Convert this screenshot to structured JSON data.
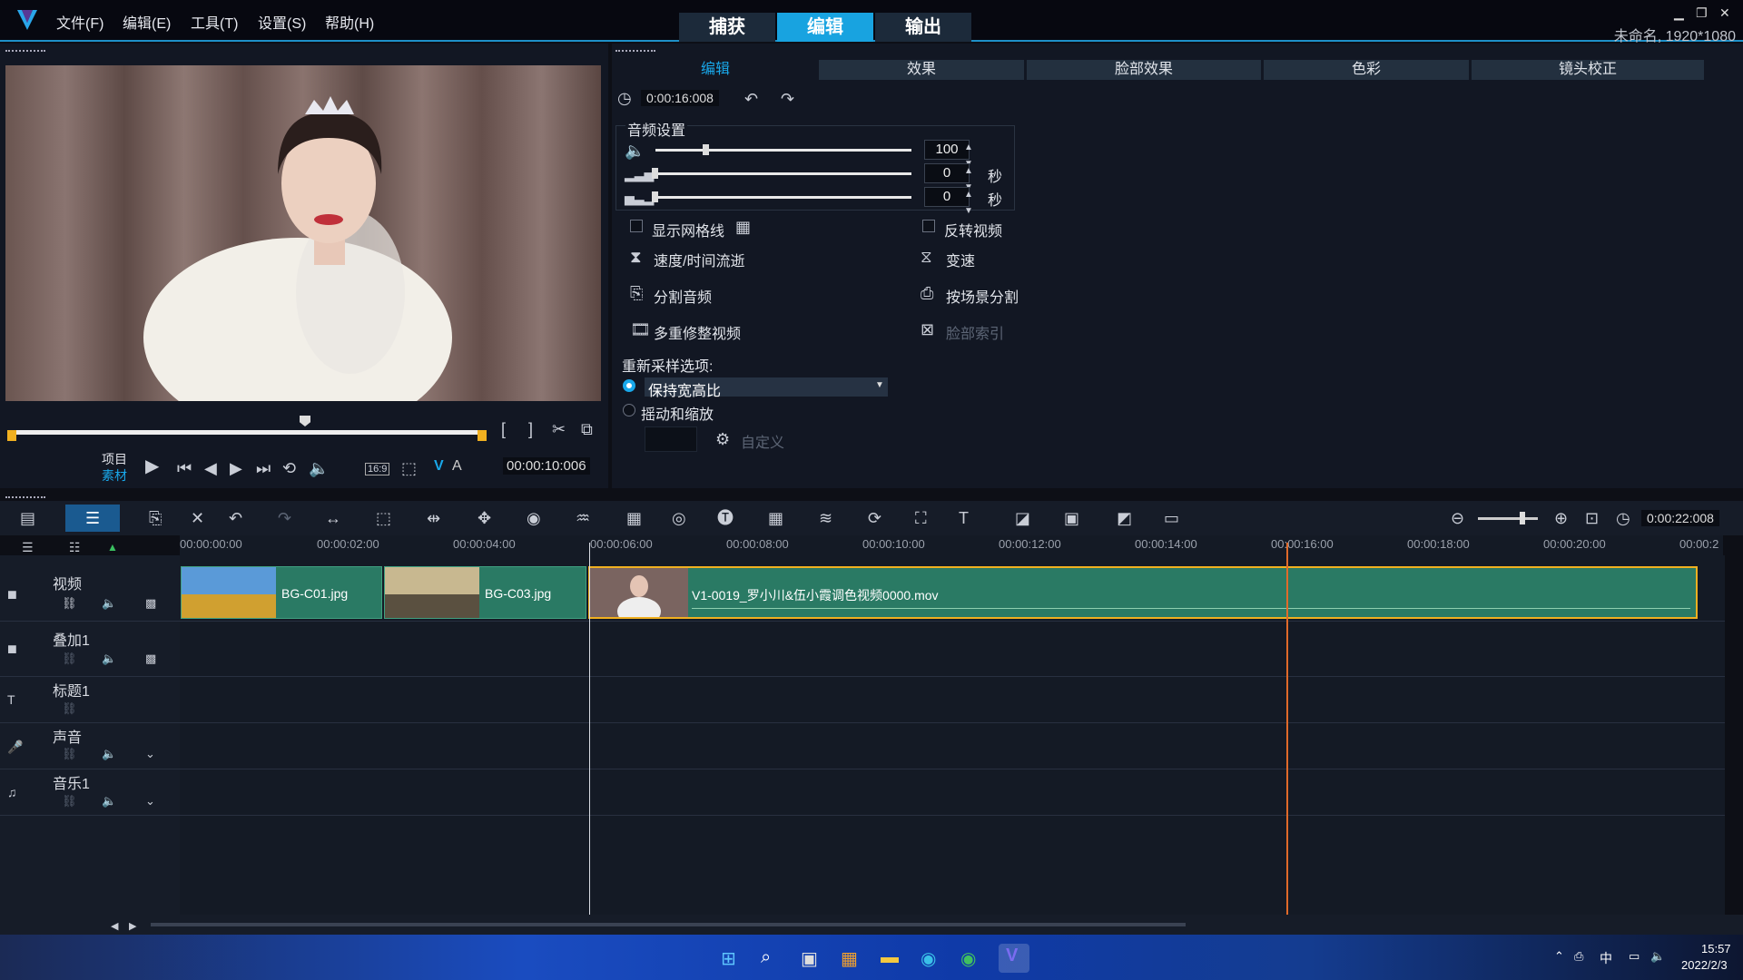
{
  "menu": {
    "file": "文件(F)",
    "edit": "编辑(E)",
    "tools": "工具(T)",
    "settings": "设置(S)",
    "help": "帮助(H)"
  },
  "modes": {
    "capture": "捕获",
    "edit": "编辑",
    "output": "输出"
  },
  "window": {
    "title": "未命名, 1920*1080"
  },
  "player": {
    "project_label": "项目",
    "clip_label": "素材",
    "aspect": "16:9",
    "timecode": "00:00:10:006",
    "v_label": "V",
    "a_label": "A"
  },
  "tabs": [
    "编辑",
    "效果",
    "脸部效果",
    "色彩",
    "镜头校正"
  ],
  "options": {
    "duration": "0:00:16:008",
    "audio_title": "音频设置",
    "volume": "100",
    "fade_in": "0",
    "fade_out": "0",
    "sec": "秒",
    "show_grid": "显示网格线",
    "reverse": "反转视频",
    "speed_time": "速度/时间流逝",
    "var_speed": "变速",
    "split_audio": "分割音频",
    "scene_split": "按场景分割",
    "multi_trim": "多重修整视频",
    "face_index": "脸部索引",
    "resample_title": "重新采样选项:",
    "keep_aspect": "保持宽高比",
    "pan_zoom": "摇动和缩放",
    "custom": "自定义"
  },
  "timeline": {
    "total_time": "0:00:22:008",
    "ticks": [
      "00:00:00:00",
      "00:00:02:00",
      "00:00:04:00",
      "00:00:06:00",
      "00:00:08:00",
      "00:00:10:00",
      "00:00:12:00",
      "00:00:14:00",
      "00:00:16:00",
      "00:00:18:00",
      "00:00:20:00",
      "00:00:2"
    ],
    "tracks": [
      {
        "name": "视频"
      },
      {
        "name": "叠加1"
      },
      {
        "name": "标题1"
      },
      {
        "name": "声音"
      },
      {
        "name": "音乐1"
      }
    ],
    "clips": [
      {
        "label": "BG-C01.jpg"
      },
      {
        "label": "BG-C03.jpg"
      },
      {
        "label": "V1-0019_罗小川&伍小霞调色视频0000.mov"
      }
    ]
  },
  "taskbar": {
    "time": "15:57",
    "date": "2022/2/3",
    "ime": "中"
  },
  "colors": {
    "accent": "#18a3e0",
    "clip": "#2a7a64",
    "marker": "#e06a2a"
  }
}
